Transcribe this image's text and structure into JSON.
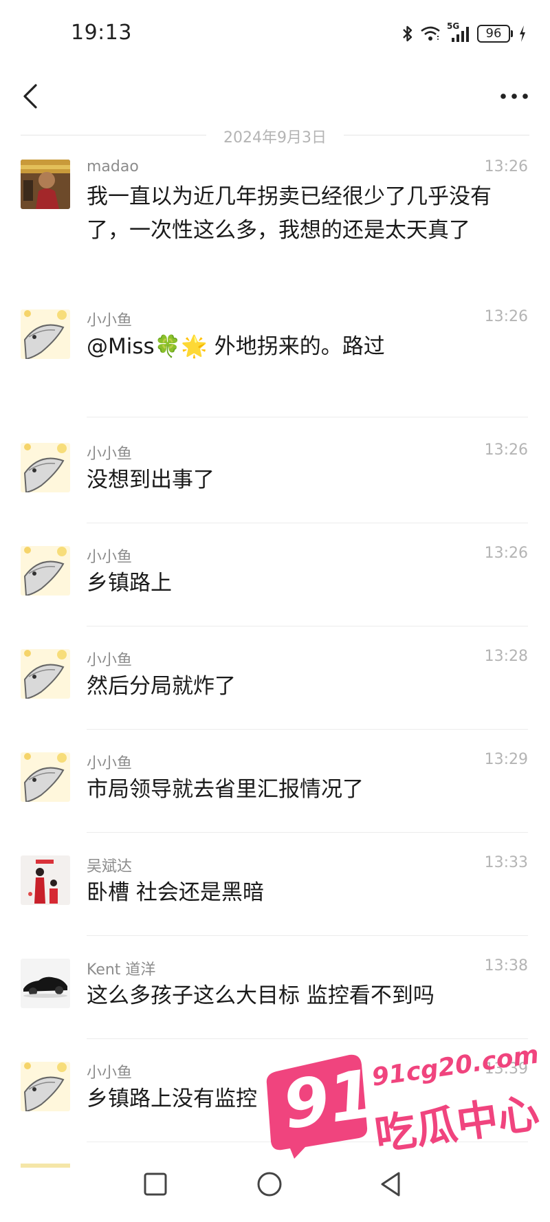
{
  "status_bar": {
    "time": "19:13",
    "battery": "96",
    "signal_label": "5G",
    "icons": [
      "bluetooth-icon",
      "wifi-icon",
      "signal-icon",
      "battery-icon",
      "charging-icon"
    ]
  },
  "nav": {
    "back_icon": "chevron-left-icon",
    "more_icon": "more-dots-icon"
  },
  "date_divider": "2024年9月3日",
  "messages": [
    {
      "sender": "madao",
      "time": "13:26",
      "text": "我一直以为近几年拐卖已经很少了几乎没有了，一次性这么多，我想的还是太天真了",
      "avatar": "avatar-madao"
    },
    {
      "sender": "小小鱼",
      "time": "13:26",
      "text": "@Miss🍀🌟 外地拐来的。路过",
      "avatar": "avatar-fish"
    },
    {
      "sender": "小小鱼",
      "time": "13:26",
      "text": "没想到出事了",
      "avatar": "avatar-fish"
    },
    {
      "sender": "小小鱼",
      "time": "13:26",
      "text": "乡镇路上",
      "avatar": "avatar-fish"
    },
    {
      "sender": "小小鱼",
      "time": "13:28",
      "text": "然后分局就炸了",
      "avatar": "avatar-fish"
    },
    {
      "sender": "小小鱼",
      "time": "13:29",
      "text": "市局领导就去省里汇报情况了",
      "avatar": "avatar-fish"
    },
    {
      "sender": "吴斌达",
      "time": "13:33",
      "text": "卧槽  社会还是黑暗",
      "avatar": "avatar-family"
    },
    {
      "sender": "Kent 道洋",
      "time": "13:38",
      "text": "这么多孩子这么大目标   监控看不到吗",
      "avatar": "avatar-car"
    },
    {
      "sender": "小小鱼",
      "time": "13:39",
      "text": "乡镇路上没有监控",
      "avatar": "avatar-fish"
    }
  ],
  "watermark": {
    "number": "91",
    "domain": "91cg20.com",
    "name": "吃瓜中心",
    "color": "#f0447e"
  },
  "system_nav": [
    "recent-apps-icon",
    "home-icon",
    "back-triangle-icon"
  ]
}
